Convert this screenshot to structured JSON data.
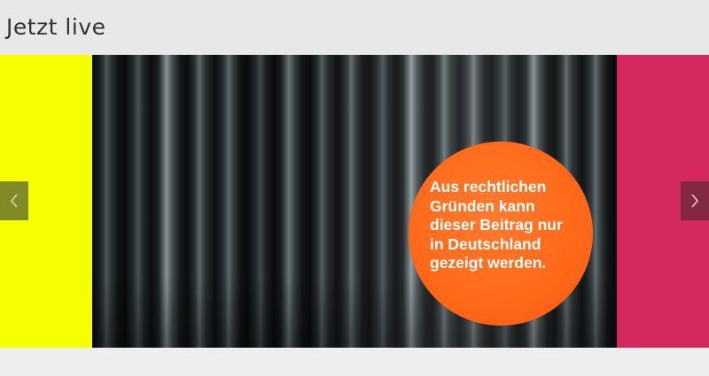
{
  "section": {
    "title": "Jetzt live"
  },
  "carousel": {
    "geo_notice": "Aus rechtlichen\nGründen kann\ndieser Beitrag nur\nin Deutschland\ngezeigt werden.",
    "prev_icon": "chevron-left-icon",
    "next_icon": "chevron-right-icon"
  },
  "colors": {
    "prev_slide": "#f5ff00",
    "next_slide": "#d4295e",
    "badge": "#ff6a1a",
    "header_bg": "#e8e8e8"
  }
}
